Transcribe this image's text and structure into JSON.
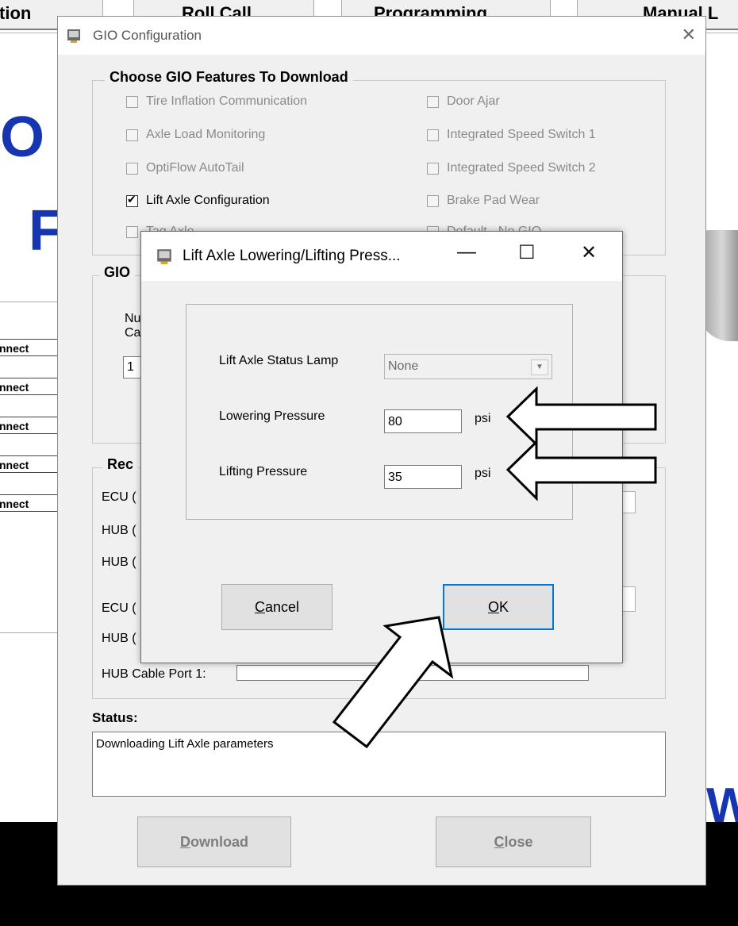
{
  "background": {
    "tabs": [
      "tion",
      "Roll Call",
      "Programming",
      "Manual L"
    ],
    "big_left_1": "O",
    "big_left_2": "F",
    "big_right": "W",
    "connect_items": [
      "nnect",
      "nnect",
      "nnect",
      "nnect",
      "nnect"
    ]
  },
  "main_dialog": {
    "title": "GIO Configuration",
    "features_group": {
      "title": "Choose GIO Features To Download",
      "left": [
        {
          "label": "Tire Inflation Communication",
          "checked": false,
          "enabled": false
        },
        {
          "label": "Axle Load Monitoring",
          "checked": false,
          "enabled": false
        },
        {
          "label": "OptiFlow AutoTail",
          "checked": false,
          "enabled": false
        },
        {
          "label": "Lift Axle Configuration",
          "checked": true,
          "enabled": true
        },
        {
          "label": "Tag Axle",
          "checked": false,
          "enabled": false
        }
      ],
      "right": [
        {
          "label": "Door Ajar",
          "checked": false,
          "enabled": false
        },
        {
          "label": "Integrated Speed Switch 1",
          "checked": false,
          "enabled": false
        },
        {
          "label": "Integrated Speed Switch 2",
          "checked": false,
          "enabled": false
        },
        {
          "label": "Brake Pad Wear",
          "checked": false,
          "enabled": false
        },
        {
          "label": "Default - No GIO",
          "checked": false,
          "enabled": false
        }
      ]
    },
    "gio_group": {
      "title": "GIO",
      "label_1": "Nu",
      "label_2": "Ca",
      "value": "1"
    },
    "rec_group": {
      "title": "Rec",
      "rows": [
        "ECU (",
        "HUB (",
        "HUB (",
        "ECU (",
        "HUB (",
        "HUB Cable Port 1:"
      ]
    },
    "status": {
      "label": "Status:",
      "text": "Downloading Lift Axle parameters"
    },
    "download_button": {
      "pre": "",
      "mnemonic": "D",
      "post": "ownload"
    },
    "close_button": {
      "pre": "",
      "mnemonic": "C",
      "post": "lose"
    }
  },
  "sub_dialog": {
    "title": "Lift Axle Lowering/Lifting Press...",
    "controls": {
      "minimize": "—",
      "maximize": "☐",
      "close": "✕"
    },
    "status_lamp_label": "Lift Axle Status Lamp",
    "status_lamp_value": "None",
    "lowering_label": "Lowering Pressure",
    "lowering_value": "80",
    "lowering_unit": "psi",
    "lifting_label": "Lifting Pressure",
    "lifting_value": "35",
    "lifting_unit": "psi",
    "cancel_button": {
      "pre": "",
      "mnemonic": "C",
      "post": "ancel"
    },
    "ok_button": {
      "pre": "",
      "mnemonic": "O",
      "post": "K"
    }
  }
}
